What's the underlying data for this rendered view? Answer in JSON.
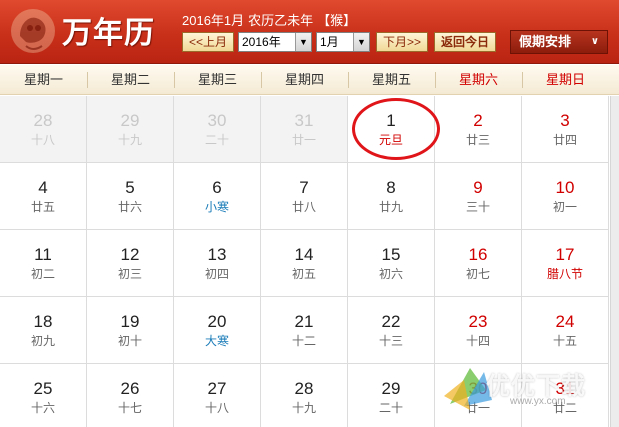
{
  "header": {
    "app_title": "万年历",
    "logo_icon": "monkey-zodiac-seal",
    "date_info": {
      "solar": "2016年1月",
      "lunar": "农历乙未年",
      "zodiac": "【猴】"
    },
    "prev_month_label": "<<上月",
    "year_select_value": "2016年",
    "month_select_value": "1月",
    "next_month_label": "下月>>",
    "today_label": "返回今日",
    "holiday_dropdown_label": "假期安排",
    "colors": {
      "header_red": "#c9301a",
      "weekend_red": "#d10000",
      "solar_term_blue": "#1a7cb8"
    }
  },
  "weekdays": [
    {
      "label": "星期一",
      "weekend": false
    },
    {
      "label": "星期二",
      "weekend": false
    },
    {
      "label": "星期三",
      "weekend": false
    },
    {
      "label": "星期四",
      "weekend": false
    },
    {
      "label": "星期五",
      "weekend": false
    },
    {
      "label": "星期六",
      "weekend": true
    },
    {
      "label": "星期日",
      "weekend": true
    }
  ],
  "weeks": [
    [
      {
        "day": "28",
        "lunar": "十八",
        "prev": true
      },
      {
        "day": "29",
        "lunar": "十九",
        "prev": true
      },
      {
        "day": "30",
        "lunar": "二十",
        "prev": true
      },
      {
        "day": "31",
        "lunar": "廿一",
        "prev": true
      },
      {
        "day": "1",
        "lunar": "元旦",
        "festival": true,
        "today": true
      },
      {
        "day": "2",
        "lunar": "廿三",
        "weekend": true
      },
      {
        "day": "3",
        "lunar": "廿四",
        "weekend": true
      }
    ],
    [
      {
        "day": "4",
        "lunar": "廿五"
      },
      {
        "day": "5",
        "lunar": "廿六"
      },
      {
        "day": "6",
        "lunar": "小寒",
        "term": true
      },
      {
        "day": "7",
        "lunar": "廿八"
      },
      {
        "day": "8",
        "lunar": "廿九"
      },
      {
        "day": "9",
        "lunar": "三十",
        "weekend": true
      },
      {
        "day": "10",
        "lunar": "初一",
        "weekend": true
      }
    ],
    [
      {
        "day": "11",
        "lunar": "初二"
      },
      {
        "day": "12",
        "lunar": "初三"
      },
      {
        "day": "13",
        "lunar": "初四"
      },
      {
        "day": "14",
        "lunar": "初五"
      },
      {
        "day": "15",
        "lunar": "初六"
      },
      {
        "day": "16",
        "lunar": "初七",
        "weekend": true
      },
      {
        "day": "17",
        "lunar": "腊八节",
        "weekend": true,
        "festival": true
      }
    ],
    [
      {
        "day": "18",
        "lunar": "初九"
      },
      {
        "day": "19",
        "lunar": "初十"
      },
      {
        "day": "20",
        "lunar": "大寒",
        "term": true
      },
      {
        "day": "21",
        "lunar": "十二"
      },
      {
        "day": "22",
        "lunar": "十三"
      },
      {
        "day": "23",
        "lunar": "十四",
        "weekend": true
      },
      {
        "day": "24",
        "lunar": "十五",
        "weekend": true
      }
    ],
    [
      {
        "day": "25",
        "lunar": "十六"
      },
      {
        "day": "26",
        "lunar": "十七"
      },
      {
        "day": "27",
        "lunar": "十八"
      },
      {
        "day": "28",
        "lunar": "十九"
      },
      {
        "day": "29",
        "lunar": "二十"
      },
      {
        "day": "30",
        "lunar": "廿一",
        "weekend": true
      },
      {
        "day": "31",
        "lunar": "廿二",
        "weekend": true
      }
    ]
  ],
  "watermark": {
    "text": "优优下载",
    "url": "www.yx.com"
  }
}
